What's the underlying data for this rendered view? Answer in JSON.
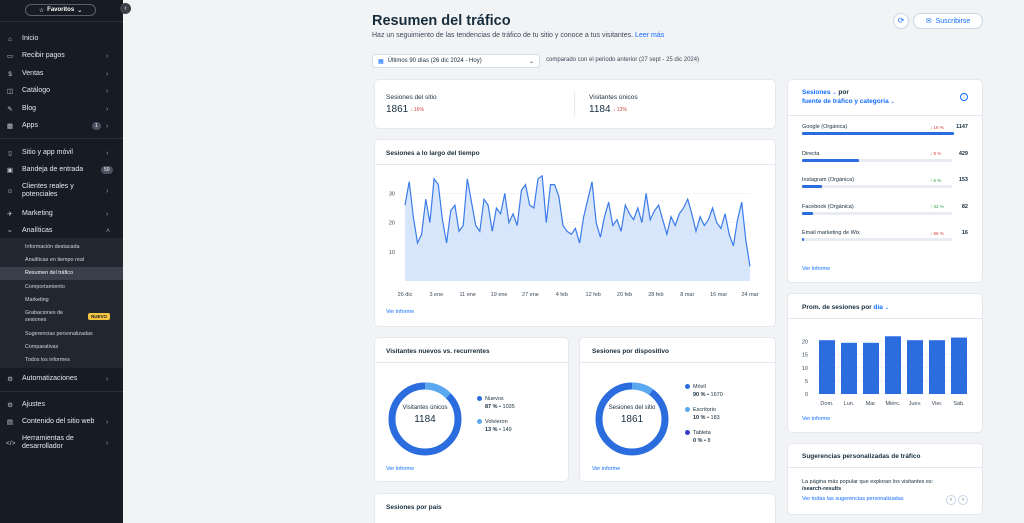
{
  "sidebar": {
    "favorites": "Favoritos",
    "collapse_icon": "chevron-left",
    "items": [
      {
        "label": "Inicio",
        "icon": "home"
      },
      {
        "label": "Recibir pagos",
        "icon": "payments"
      },
      {
        "label": "Ventas",
        "icon": "sales"
      },
      {
        "label": "Catálogo",
        "icon": "catalog"
      },
      {
        "label": "Blog",
        "icon": "blog"
      },
      {
        "label": "Apps",
        "icon": "apps",
        "count": "1"
      },
      {
        "label": "Sitio y app móvil",
        "icon": "mobile"
      },
      {
        "label": "Bandeja de entrada",
        "icon": "inbox",
        "count": "50"
      },
      {
        "label": "Clientes reales y potenciales",
        "icon": "customers"
      },
      {
        "label": "Marketing",
        "icon": "marketing"
      },
      {
        "label": "Analíticas",
        "icon": "analytics"
      },
      {
        "label": "Automatizaciones",
        "icon": "automations"
      },
      {
        "label": "Ajustes",
        "icon": "settings"
      },
      {
        "label": "Contenido del sitio web",
        "icon": "content"
      },
      {
        "label": "Herramientas de desarrollador",
        "icon": "code"
      }
    ],
    "analytics_sub": [
      "Información destacada",
      "Analíticas en tiempo real",
      "Resumen del tráfico",
      "Comportamiento",
      "Marketing",
      "Grabaciones de sesiones",
      "Sugerencias personalizadas",
      "Comparativas",
      "Todos los informes"
    ],
    "new_badge": "NUEVO"
  },
  "header": {
    "title": "Resumen del tráfico",
    "subtitle": "Haz un seguimiento de las tendencias de tráfico de tu sitio y conoce a tus visitantes.",
    "learn_more": "Leer más",
    "subscribe": "Suscribirse",
    "date_range": "Últimos 90 días (26 dic 2024 - Hoy)",
    "compare": "comparado con el periodo anterior (27 sept - 25 dic 2024)"
  },
  "stats": {
    "sessions_label": "Sesiones del sitio",
    "sessions_value": "1861",
    "sessions_delta": "16%",
    "visitors_label": "Visitantes únicos",
    "visitors_value": "1184",
    "visitors_delta": "13%"
  },
  "report_link": "Ver informe",
  "sessions_over_time": {
    "title": "Sesiones a lo largo del tiempo"
  },
  "sources": {
    "title_prefix": "Sesiones",
    "title_mid": "por",
    "title_link": "fuente de tráfico y categoría",
    "rows": [
      {
        "name": "Google (Orgánica)",
        "pct": "18 %",
        "dir": "down",
        "value": "1147",
        "share": 0.616
      },
      {
        "name": "Directa",
        "pct": "9 %",
        "dir": "down",
        "value": "429",
        "share": 0.23
      },
      {
        "name": "Instagram (Orgánica)",
        "pct": "6 %",
        "dir": "up",
        "value": "153",
        "share": 0.082
      },
      {
        "name": "Facebook (Orgánica)",
        "pct": "32 %",
        "dir": "up",
        "value": "82",
        "share": 0.044
      },
      {
        "name": "Email marketing de Wix",
        "pct": "86 %",
        "dir": "down",
        "value": "16",
        "share": 0.009
      }
    ]
  },
  "new_returning": {
    "title": "Visitantes nuevos vs. recurrentes",
    "center_label": "Visitantes únicos",
    "center_value": "1184",
    "legend": [
      {
        "name": "Nuevos",
        "pct": "87 %",
        "value": "1035",
        "color": "#2b6cdf"
      },
      {
        "name": "Volvieron",
        "pct": "13 %",
        "value": "149",
        "color": "#5aa9f0"
      }
    ]
  },
  "device": {
    "title": "Sesiones por dispositivo",
    "center_label": "Sesiones del sitio",
    "center_value": "1861",
    "legend": [
      {
        "name": "Móvil",
        "pct": "90 %",
        "value": "1670",
        "color": "#2b6cdf"
      },
      {
        "name": "Escritorio",
        "pct": "10 %",
        "value": "183",
        "color": "#5aa9f0"
      },
      {
        "name": "Tableta",
        "pct": "0 %",
        "value": "8",
        "color": "#3a3cc8"
      }
    ]
  },
  "avg_sessions": {
    "title_prefix": "Prom. de sesiones por",
    "title_link": "día"
  },
  "personalized": {
    "title": "Sugerencias personalizadas de tráfico",
    "text": "La página más popular que exploran los visitantes es:",
    "path": "/search-results",
    "link": "Ver todas las sugerencias personalizadas"
  },
  "country": {
    "title": "Sesiones por país"
  },
  "colors": {
    "accent": "#116dff",
    "bar": "#2b6cdf",
    "sidebar": "#171b24",
    "negative": "#d1453b",
    "positive": "#2f9e44"
  },
  "chart_data": [
    {
      "type": "area",
      "title": "Sesiones a lo largo del tiempo",
      "x_ticks": [
        "26 dic",
        "3 ene",
        "11 ene",
        "19 ene",
        "27 ene",
        "4 feb",
        "12 feb",
        "20 feb",
        "28 feb",
        "8 mar",
        "16 mar",
        "24 mar"
      ],
      "y_ticks": [
        10,
        20,
        30
      ],
      "ylim": [
        0,
        38
      ],
      "grid": true,
      "values": [
        26,
        34,
        22,
        13,
        16,
        28,
        20,
        35,
        33,
        21,
        13,
        24,
        26,
        17,
        19,
        35,
        27,
        19,
        17,
        28,
        26,
        17,
        25,
        23,
        30,
        20,
        23,
        19,
        31,
        33,
        26,
        25,
        35,
        36,
        20,
        33,
        33,
        29,
        19,
        17,
        16,
        18,
        13,
        22,
        28,
        34,
        20,
        15,
        22,
        27,
        19,
        21,
        17,
        26,
        23,
        21,
        25,
        20,
        30,
        21,
        24,
        26,
        21,
        16,
        22,
        19,
        23,
        25,
        28,
        23,
        17,
        22,
        19,
        21,
        25,
        20,
        18,
        23,
        16,
        12,
        21,
        27,
        14,
        5
      ]
    },
    {
      "type": "bar",
      "title": "Prom. de sesiones por día",
      "categories": [
        "Dom.",
        "Lun.",
        "Mar.",
        "Miérc.",
        "Juev.",
        "Vier.",
        "Sáb."
      ],
      "values": [
        20.5,
        19.5,
        19.5,
        22.0,
        20.5,
        20.5,
        21.5
      ],
      "y_ticks": [
        0,
        5,
        10,
        15,
        20
      ],
      "ylim": [
        0,
        24
      ],
      "grid": true
    }
  ]
}
